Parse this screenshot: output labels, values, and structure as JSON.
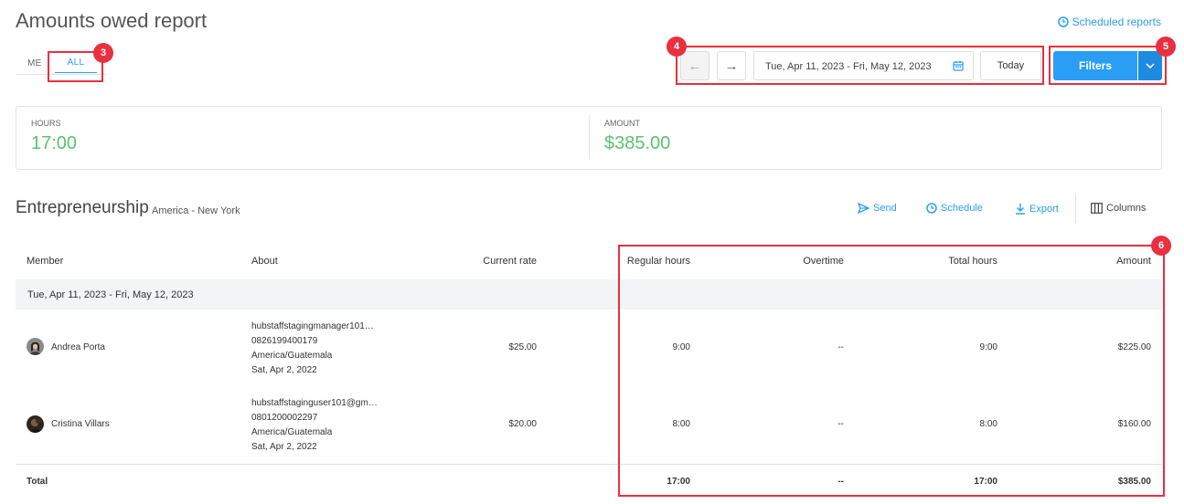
{
  "header": {
    "title": "Amounts owed report",
    "scheduled_reports": "Scheduled reports"
  },
  "tabs": [
    {
      "label": "ME"
    },
    {
      "label": "ALL"
    }
  ],
  "date_range": {
    "label": "Tue, Apr 11, 2023 - Fri, May 12, 2023",
    "today": "Today"
  },
  "filters": {
    "label": "Filters"
  },
  "summary": {
    "hours_label": "HOURS",
    "hours_value": "17:00",
    "amount_label": "AMOUNT",
    "amount_value": "$385.00"
  },
  "org": {
    "name": "Entrepreneurship",
    "timezone": "America - New York"
  },
  "toolbar": {
    "send": "Send",
    "schedule": "Schedule",
    "export": "Export",
    "columns": "Columns"
  },
  "table": {
    "headers": {
      "member": "Member",
      "about": "About",
      "rate": "Current rate",
      "regular": "Regular hours",
      "overtime": "Overtime",
      "total": "Total hours",
      "amount": "Amount"
    },
    "group_label": "Tue, Apr 11, 2023 - Fri, May 12, 2023",
    "rows": [
      {
        "member": "Andrea Porta",
        "about": [
          "hubstaffstagingmanager101…",
          "0826199400179",
          "America/Guatemala",
          "Sat, Apr 2, 2022"
        ],
        "rate": "$25.00",
        "regular": "9:00",
        "overtime": "--",
        "total": "9:00",
        "amount": "$225.00"
      },
      {
        "member": "Cristina Villars",
        "about": [
          "hubstaffstaginguser101@gm…",
          "0801200002297",
          "America/Guatemala",
          "Sat, Apr 2, 2022"
        ],
        "rate": "$20.00",
        "regular": "8:00",
        "overtime": "--",
        "total": "8:00",
        "amount": "$160.00"
      }
    ],
    "totals": {
      "label": "Total",
      "regular": "17:00",
      "overtime": "--",
      "total": "17:00",
      "amount": "$385.00"
    }
  },
  "annotations": [
    {
      "num": "3"
    },
    {
      "num": "4"
    },
    {
      "num": "5"
    },
    {
      "num": "6"
    }
  ],
  "colors": {
    "accent": "#2a9df4",
    "positive": "#5ac46b",
    "annotation": "#e8303f"
  }
}
